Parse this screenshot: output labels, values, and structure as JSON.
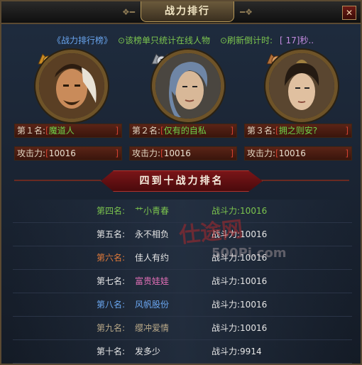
{
  "window": {
    "title": "战力排行",
    "close_label": "✕"
  },
  "info": {
    "board_name": "《战力排行榜》",
    "note": "⊙该榜单只统计在线人物",
    "refresh_label": "⊙刷新倒计时:",
    "refresh_value": "[ 17]秒.."
  },
  "top3": [
    {
      "rank_label": "第１名:",
      "name": "魔道人",
      "power_label": "攻击力:",
      "power": "10016",
      "medal": "1",
      "color": "#6fd44a"
    },
    {
      "rank_label": "第２名:",
      "name": "仅有的自私",
      "power_label": "攻击力:",
      "power": "10016",
      "medal": "2",
      "color": "#6fd44a"
    },
    {
      "rank_label": "第３名:",
      "name": "拥之则安?",
      "power_label": "攻击力:",
      "power": "10016",
      "medal": "3",
      "color": "#6fd44a"
    }
  ],
  "ranking_banner": "四到十战力排名",
  "ranks": [
    {
      "rank": "第四名:",
      "name": "艹小青春",
      "power_label": "战斗力:",
      "power": "10016",
      "rank_color": "rk-g",
      "power_color": "pw-g"
    },
    {
      "rank": "第五名:",
      "name": "永不相负",
      "power_label": "战斗力:",
      "power": "10016",
      "rank_color": "rk-w",
      "power_color": "pw-w"
    },
    {
      "rank": "第六名:",
      "name": "佳人有约",
      "power_label": "战斗力:",
      "power": "10016",
      "rank_color": "rk-o",
      "power_color": "pw-w"
    },
    {
      "rank": "第七名:",
      "name": "富贵娃娃",
      "power_label": "战斗力:",
      "power": "10016",
      "rank_color": "rk-w",
      "power_color": "pw-w"
    },
    {
      "rank": "第八名:",
      "name": "风帆股份",
      "power_label": "战斗力:",
      "power": "10016",
      "rank_color": "rk-b",
      "power_color": "pw-w"
    },
    {
      "rank": "第九名:",
      "name": "缨冲爱情",
      "power_label": "战斗力:",
      "power": "10016",
      "rank_color": "rk-t",
      "power_color": "pw-w"
    },
    {
      "rank": "第十名:",
      "name": "发多少",
      "power_label": "战斗力:",
      "power": "9914",
      "rank_color": "rk-w",
      "power_color": "pw-w"
    }
  ],
  "watermark": {
    "text": "仕途网",
    "site": "500Pi.com"
  }
}
